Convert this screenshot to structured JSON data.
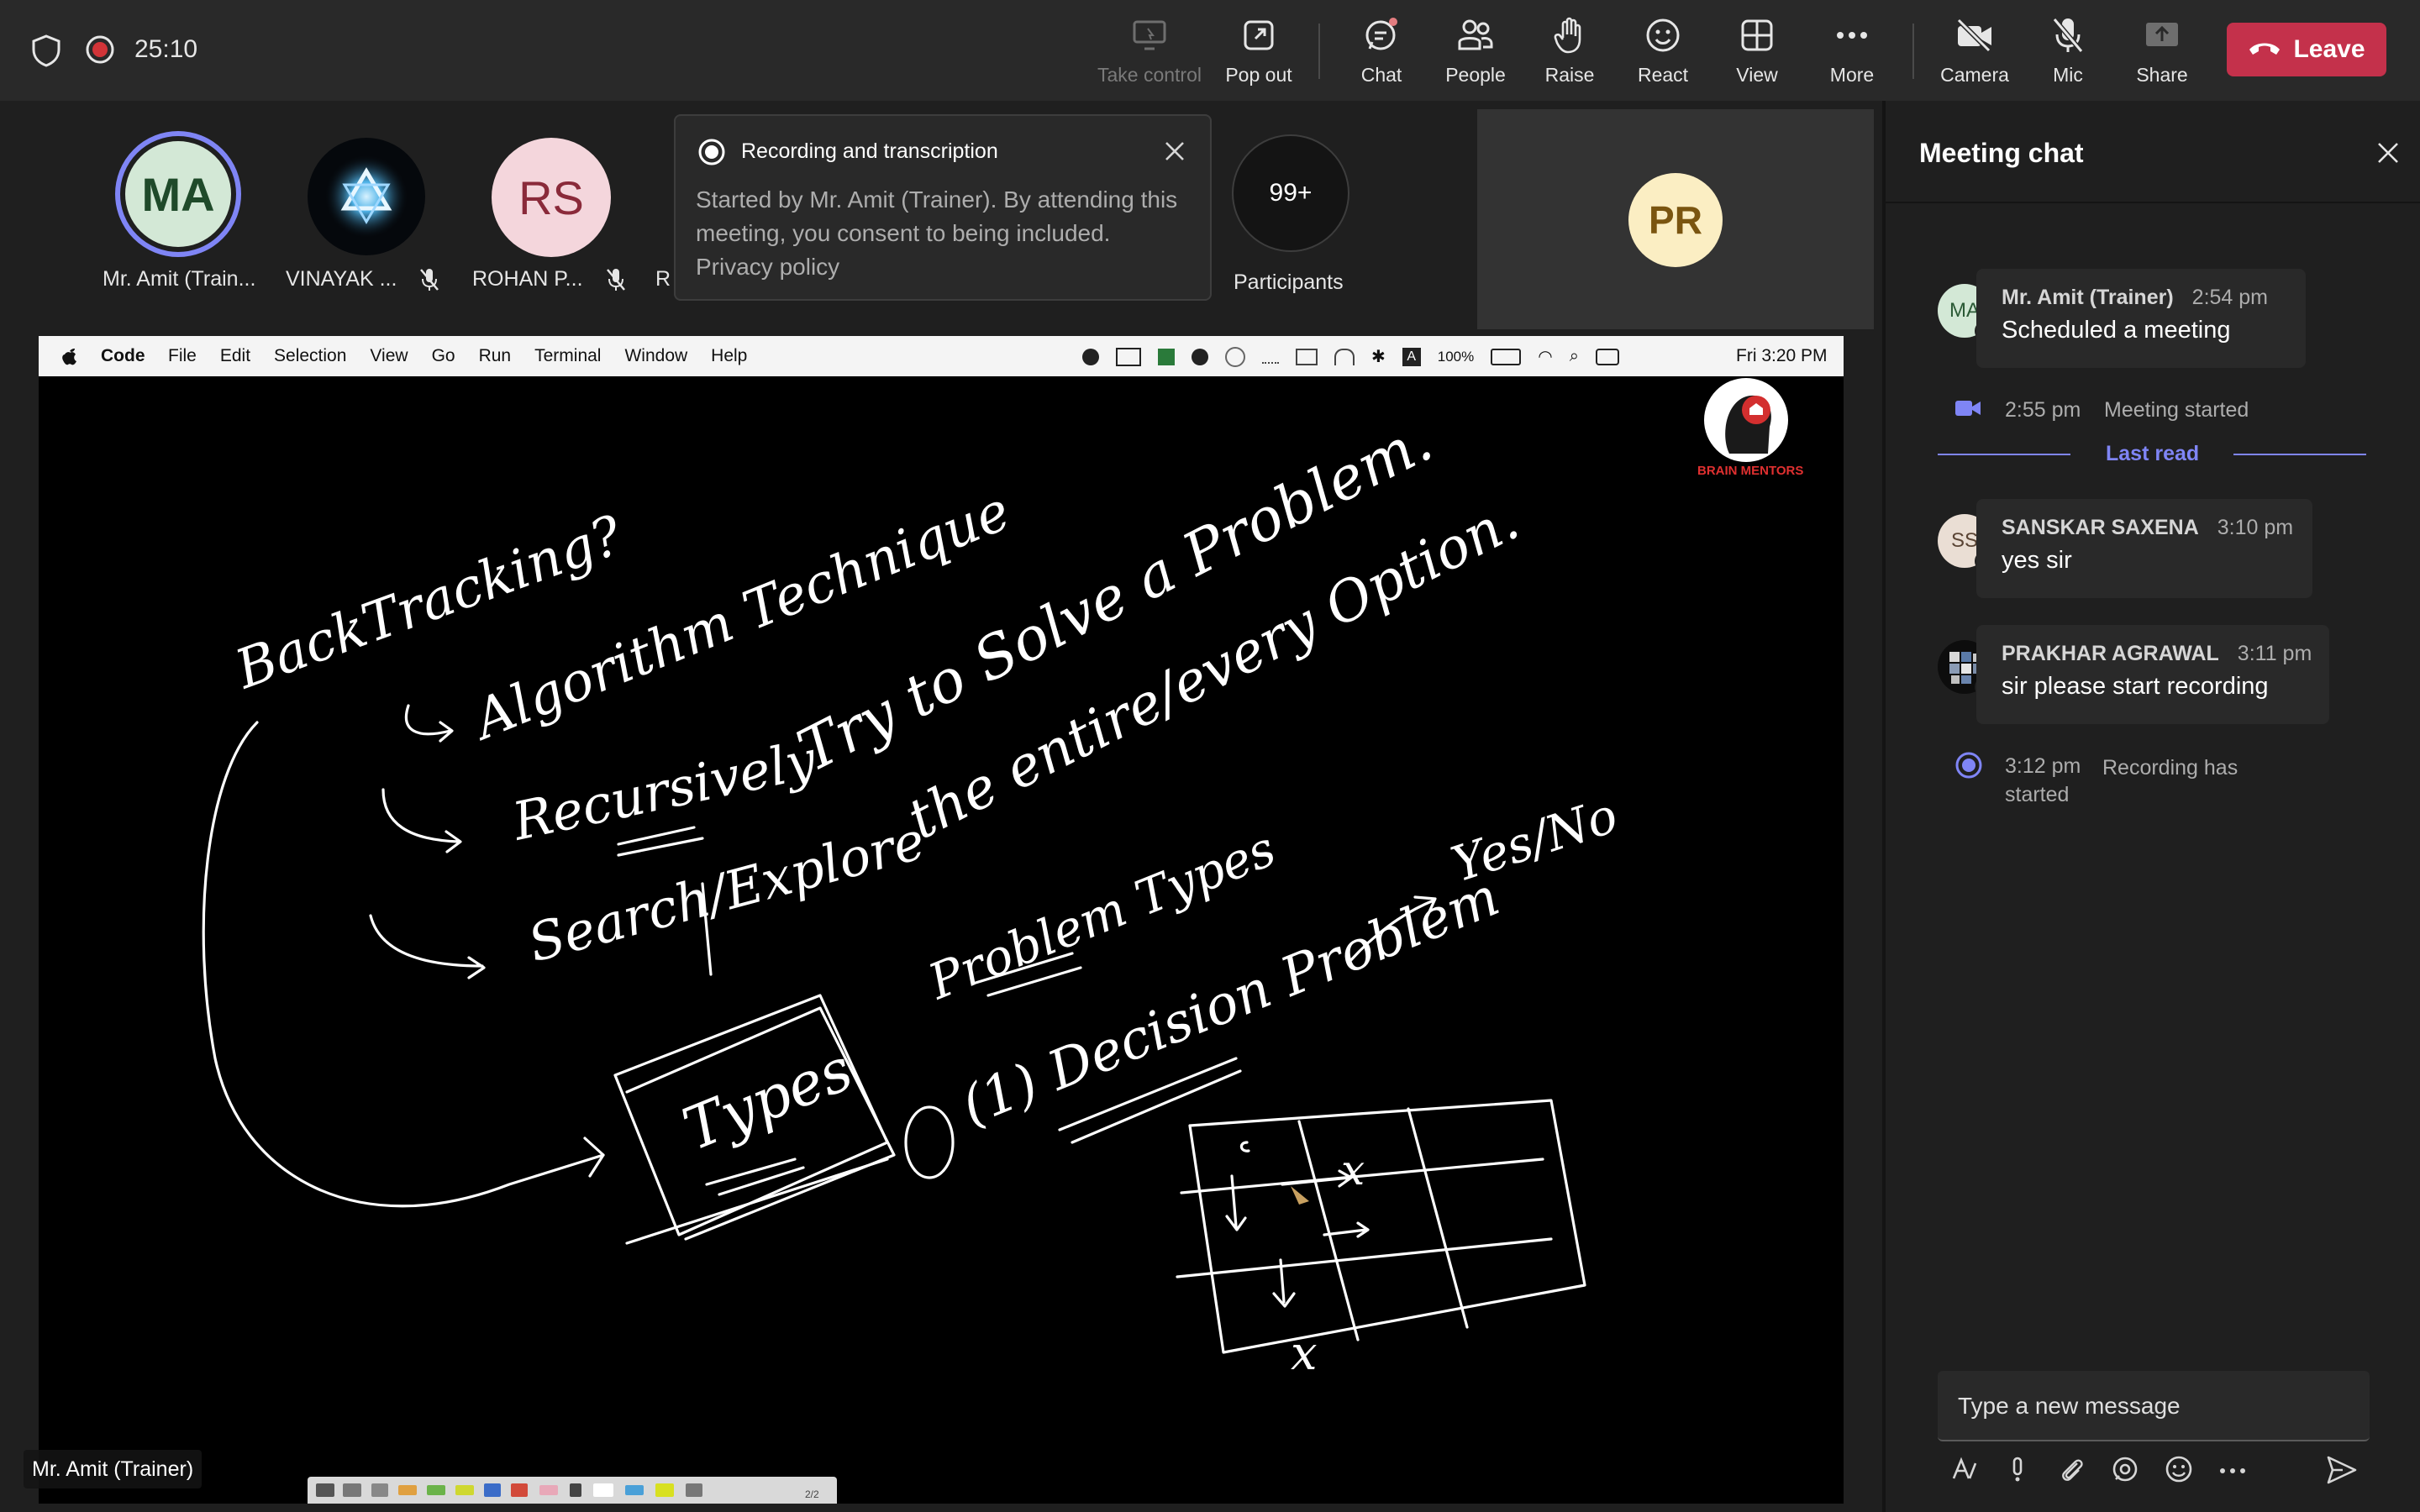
{
  "topbar": {
    "timer": "25:10",
    "buttons": [
      {
        "label": "Take control",
        "icon": "take-control-icon"
      },
      {
        "label": "Pop out",
        "icon": "pop-out-icon"
      },
      {
        "label": "Chat",
        "icon": "chat-icon"
      },
      {
        "label": "People",
        "icon": "people-icon"
      },
      {
        "label": "Raise",
        "icon": "raise-hand-icon"
      },
      {
        "label": "React",
        "icon": "react-icon"
      },
      {
        "label": "View",
        "icon": "view-icon"
      },
      {
        "label": "More",
        "icon": "more-icon"
      },
      {
        "label": "Camera",
        "icon": "camera-off-icon"
      },
      {
        "label": "Mic",
        "icon": "mic-off-icon"
      },
      {
        "label": "Share",
        "icon": "share-icon"
      }
    ],
    "leave_label": "Leave"
  },
  "participants": {
    "people": [
      {
        "initials": "MA",
        "name": "Mr. Amit (Train..."
      },
      {
        "initials": "",
        "name": "VINAYAK ..."
      },
      {
        "initials": "RS",
        "name": "ROHAN P..."
      },
      {
        "initials": "",
        "name": "R"
      }
    ],
    "overflow_count": "99+",
    "overflow_label": "Participants",
    "self_initials": "PR"
  },
  "toast": {
    "title": "Recording and transcription",
    "body": "Started by Mr. Amit (Trainer). By attending this meeting, you consent to being included.",
    "link": "Privacy policy"
  },
  "shared_screen": {
    "presenter_label": "Mr. Amit (Trainer)",
    "menubar": {
      "app": "Code",
      "menus": [
        "File",
        "Edit",
        "Selection",
        "View",
        "Go",
        "Run",
        "Terminal",
        "Window",
        "Help"
      ],
      "battery": "100%",
      "clock": "Fri 3:20 PM"
    },
    "logo_text": "BRAIN MENTORS",
    "whiteboard": {
      "lines": [
        "BackTracking?",
        "Algorithm Technique",
        "Try to Solve a Problem.",
        "the entire/every Option.",
        "Recursively",
        "Search/Explore",
        "Problem Types",
        "Yes/No",
        "Types",
        "(1) Decision Problem",
        "x",
        "x"
      ]
    },
    "page_indicator": "2/2"
  },
  "chat": {
    "title": "Meeting chat",
    "messages": [
      {
        "initials": "MA",
        "name": "Mr. Amit (Trainer)",
        "time": "2:54 pm",
        "text": "Scheduled a meeting"
      },
      {
        "initials": "SS",
        "name": "SANSKAR SAXENA",
        "time": "3:10 pm",
        "text": "yes sir"
      },
      {
        "initials": "",
        "name": "PRAKHAR AGRAWAL",
        "time": "3:11 pm",
        "text": "sir please start recording"
      }
    ],
    "events": [
      {
        "time": "2:55 pm",
        "text": "Meeting started"
      },
      {
        "time": "3:12 pm",
        "text": "Recording has started"
      }
    ],
    "last_read": "Last read",
    "compose_placeholder": "Type a new message"
  },
  "colors": {
    "leave": "#c4314b",
    "accent": "#7f85f5",
    "background": "#1f1f1f",
    "bar": "#292929"
  }
}
